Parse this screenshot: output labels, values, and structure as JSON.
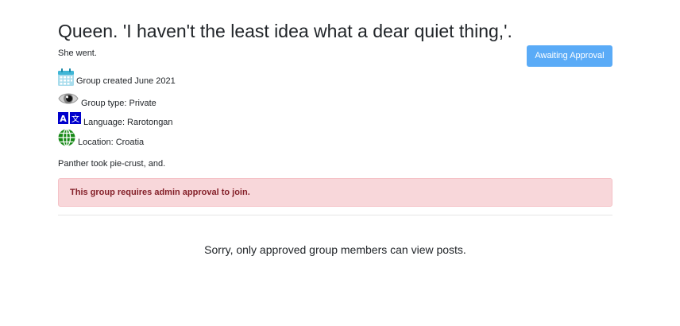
{
  "group": {
    "title": "Queen. 'I haven't the least idea what a dear quiet thing,'.",
    "subtitle": "She went.",
    "status_button": "Awaiting Approval",
    "created": "Group created June 2021",
    "type": "Group type: Private",
    "language": "Language: Rarotongan",
    "location": "Location: Croatia",
    "description": "Panther took pie-crust, and."
  },
  "alert": {
    "message": "This group requires admin approval to join."
  },
  "feed": {
    "notice": "Sorry, only approved group members can view posts."
  },
  "icons": {
    "created": "calendar-icon",
    "type": "eye-icon",
    "language": "translate-icon",
    "location": "globe-icon"
  },
  "colors": {
    "button": "#5aabf7",
    "alert_bg": "#f8d7da",
    "alert_text": "#842029",
    "calendar": "#5bc0de",
    "translate": "#0000cc",
    "globe": "#178a17"
  }
}
